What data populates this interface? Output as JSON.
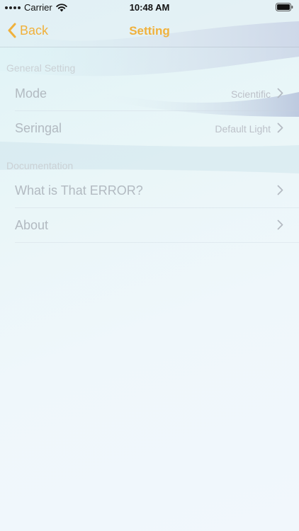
{
  "status_bar": {
    "carrier": "Carrier",
    "time": "10:48 AM"
  },
  "nav": {
    "back_label": "Back",
    "title": "Setting"
  },
  "sections": [
    {
      "header": "General Setting",
      "rows": [
        {
          "label": "Mode",
          "value": "Scientific"
        },
        {
          "label": "Seringal",
          "value": "Default Light"
        }
      ]
    },
    {
      "header": "Documentation",
      "rows": [
        {
          "label": "What is That ERROR?",
          "value": ""
        },
        {
          "label": "About",
          "value": ""
        }
      ]
    }
  ],
  "colors": {
    "accent": "#f0b13c",
    "text_muted": "#afb6be"
  },
  "icons": {
    "back": "chevron-left-icon",
    "row_disclosure": "chevron-right-icon",
    "wifi": "wifi-icon",
    "battery": "battery-icon"
  }
}
